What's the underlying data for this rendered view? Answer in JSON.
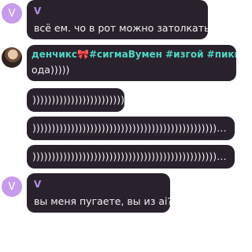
{
  "messages": [
    {
      "avatar_letter": "V",
      "sender": "V",
      "text": "всё ем. чо в рот можно затолкать"
    },
    {
      "avatar": "photo-avatar",
      "sender_name": "денчикс",
      "sender_bow": "🎀",
      "sender_tags": "#сигмаВумен #изгой #пикми",
      "text": "ода)))))"
    },
    {
      "text": "))))))))))))))))))))))))"
    },
    {
      "text": "))))))))))))))))))))))))))))))))))))))))))))))))))))))))))))…"
    },
    {
      "text": "))))))))))))))))))))))))))))))))))))))))))))))))))))))))))))…"
    },
    {
      "avatar_letter": "V",
      "sender": "V",
      "text": "вы меня пугаете, вы из ai?"
    }
  ]
}
